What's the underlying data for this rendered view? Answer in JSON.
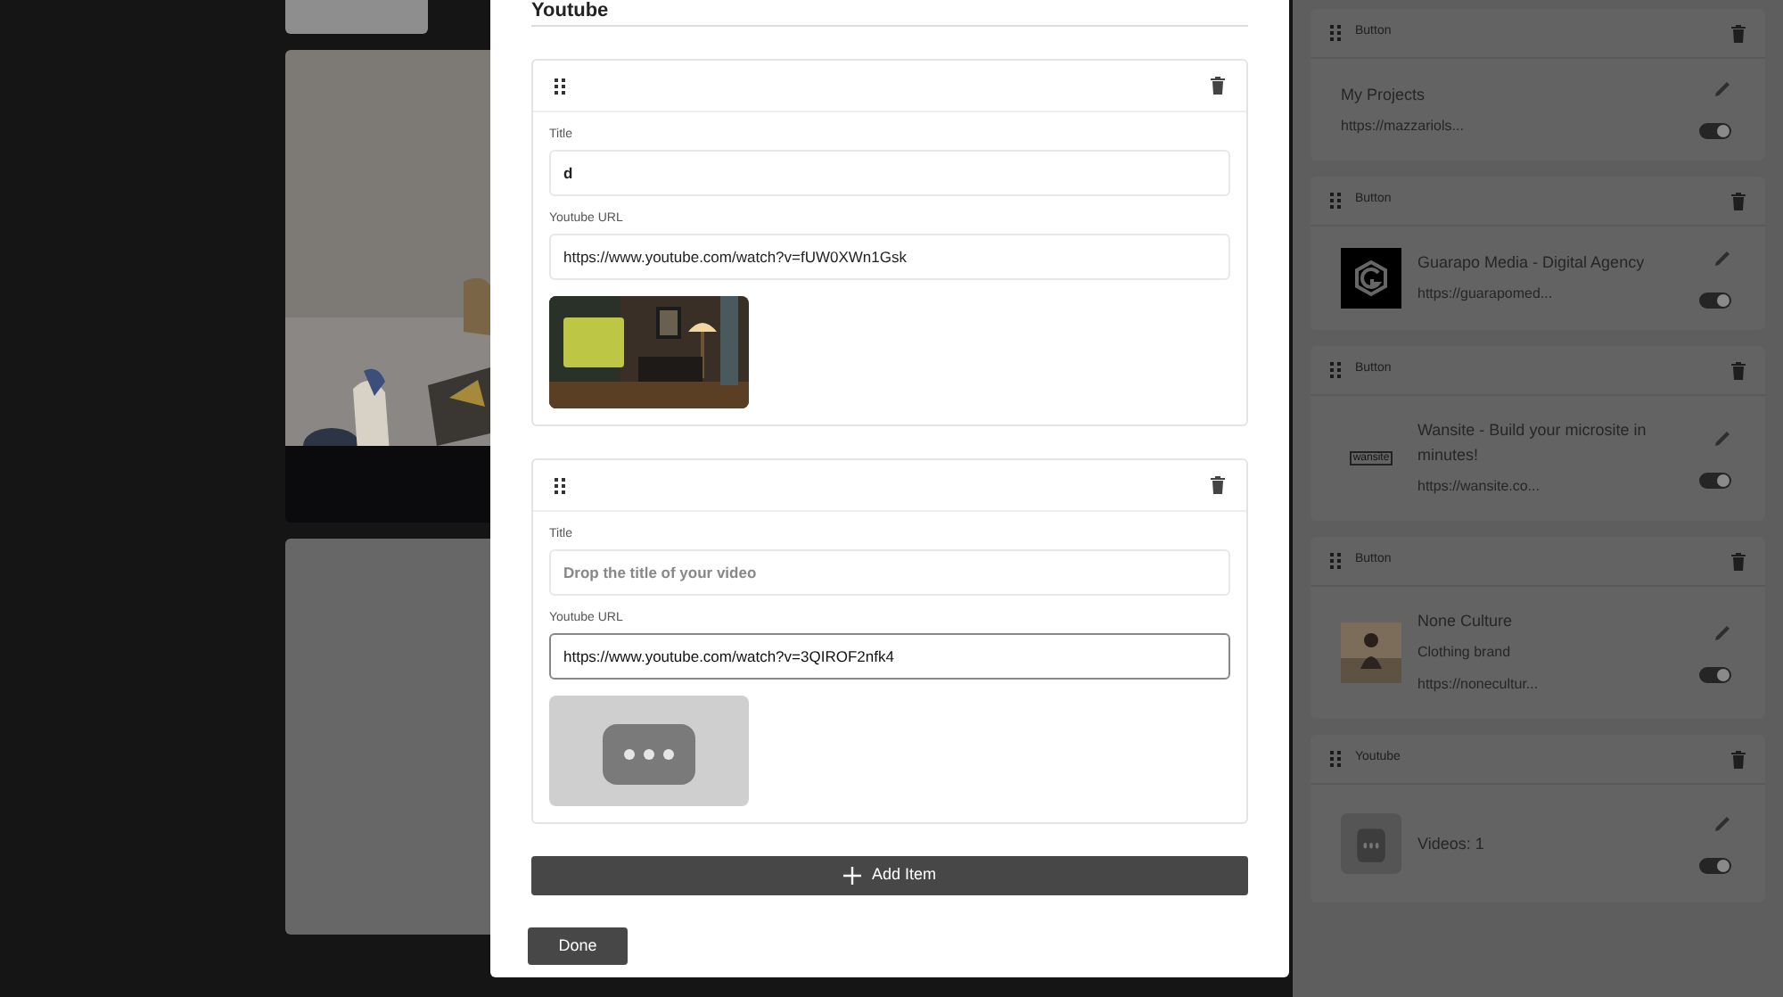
{
  "modal": {
    "title": "Youtube",
    "items": [
      {
        "title_label": "Title",
        "title_value": "d",
        "url_label": "Youtube URL",
        "url_value": "https://www.youtube.com/watch?v=fUW0XWn1Gsk",
        "focused": false
      },
      {
        "title_label": "Title",
        "title_placeholder": "Drop the title of your video",
        "url_label": "Youtube URL",
        "url_value": "https://www.youtube.com/watch?v=3QIROF2nfk4",
        "focused": true,
        "thumbnail": {
          "kind": "placeholder"
        }
      }
    ],
    "add_button": "Add Item",
    "done_button": "Done"
  },
  "blocks": [
    {
      "type_label": "Button",
      "kind": "link",
      "image": {
        "kind": "none"
      },
      "lines": [
        "My Projects",
        "https://mazzariols..."
      ],
      "enabled": true
    },
    {
      "type_label": "Button",
      "kind": "link",
      "image": {
        "kind": "hex-logo"
      },
      "lines": [
        "Guarapo Media - Digital Agency",
        "https://guarapomed..."
      ],
      "enabled": true
    },
    {
      "type_label": "Button",
      "kind": "link",
      "image": {
        "kind": "wordmark",
        "text": "wansite"
      },
      "lines": [
        "Wansite - Build your microsite in minutes!",
        "https://wansite.co..."
      ],
      "enabled": true
    },
    {
      "type_label": "Button",
      "kind": "link",
      "lines": [
        "None Culture",
        "Clothing brand",
        "https://nonecultur..."
      ],
      "enabled": true
    },
    {
      "type_label": "Youtube",
      "kind": "youtube",
      "image": {
        "kind": "placeholder"
      },
      "lines": [
        "Videos: 1"
      ],
      "enabled": true
    }
  ]
}
